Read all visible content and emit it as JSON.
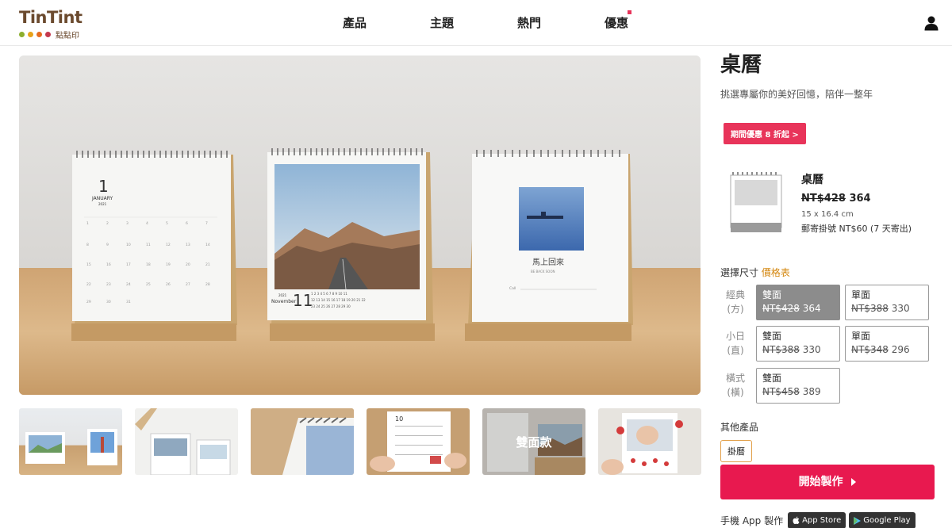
{
  "header": {
    "logo_text": "TinTint",
    "logo_sub": "點點印",
    "logo_dot_colors": [
      "#8cae2e",
      "#e8a21a",
      "#e66b1f",
      "#c5384d"
    ],
    "nav": [
      "產品",
      "主題",
      "熱門",
      "優惠"
    ],
    "nav_badge_color": "#e8345a",
    "user_icon": "user-icon"
  },
  "gallery": {
    "main_image_icon": "desk-calendar-photo",
    "main_calendars": [
      {
        "month": "1",
        "month_name": "JANUARY",
        "year": "2021"
      },
      {
        "month": "11",
        "month_name": "November",
        "year": "2021"
      },
      {
        "title": "馬上回來",
        "subtitle": "BE BACK SOON",
        "card_label": "Call"
      }
    ],
    "thumb_overlay": "雙面款"
  },
  "product": {
    "title": "桌曆",
    "subtitle": "挑選專屬你的美好回憶，陪伴一整年",
    "promo": "期間優惠 8 折起 >",
    "name": "桌曆",
    "original_price": "NT$428",
    "price": "364",
    "dimensions": "15 x 16.4 cm",
    "shipping": "郵寄掛號 NT$60 (7 天寄出)"
  },
  "sizes": {
    "label": "選擇尺寸",
    "table_link": "價格表",
    "rows": [
      {
        "label_line1": "經典",
        "label_line2": "(方)",
        "options": [
          {
            "name": "雙面",
            "original": "NT$428",
            "price": "364",
            "selected": true
          },
          {
            "name": "單面",
            "original": "NT$388",
            "price": "330",
            "selected": false
          }
        ]
      },
      {
        "label_line1": "小日",
        "label_line2": "(直)",
        "options": [
          {
            "name": "雙面",
            "original": "NT$388",
            "price": "330",
            "selected": false
          },
          {
            "name": "單面",
            "original": "NT$348",
            "price": "296",
            "selected": false
          }
        ]
      },
      {
        "label_line1": "橫式",
        "label_line2": "(橫)",
        "options": [
          {
            "name": "雙面",
            "original": "NT$458",
            "price": "389",
            "selected": false
          }
        ]
      }
    ]
  },
  "other": {
    "label": "其他產品",
    "button": "掛曆"
  },
  "cta": {
    "label": "開始製作"
  },
  "app": {
    "label": "手機 App 製作",
    "appstore": "App Store",
    "googleplay": "Google Play"
  },
  "colors": {
    "brand_red": "#e8194f",
    "accent_orange": "#d4870f"
  }
}
